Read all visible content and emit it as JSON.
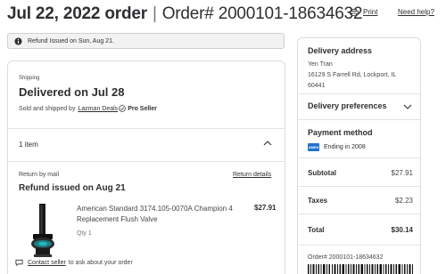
{
  "header": {
    "date_title": "Jul 22, 2022 order",
    "separator": "|",
    "order_number": "Order# 2000101-18634632",
    "print_label": "Print",
    "help_label": "Need help?"
  },
  "banner": {
    "text": "Refund Issued on Sun, Aug 21."
  },
  "shipment": {
    "label": "Shipping",
    "status": "Delivered on Jul 28",
    "sold_by_prefix": "Sold and shipped by",
    "seller": "Lazman Deals",
    "seller_badge": "Pro Seller"
  },
  "items": {
    "count_label": "1 item"
  },
  "return": {
    "method": "Return by mail",
    "details_link": "Return details",
    "status": "Refund issued on Aug 21"
  },
  "product": {
    "name": "American Standard 3174.105-0070A Champion 4 Replacement Flush Valve",
    "quantity": "Qty 1",
    "price": "$27.91"
  },
  "contact": {
    "link": "Contact seller",
    "suffix": "to ask about your order"
  },
  "sidebar": {
    "address_heading": "Delivery address",
    "address_lines": [
      "Yen Tran",
      "16129 S Farrell Rd, Lockport, IL",
      "60441"
    ],
    "preferences_heading": "Delivery preferences",
    "payment_heading": "Payment method",
    "card_brand": "AMEX",
    "card_text": "Ending in 2008",
    "subtotal_label": "Subtotal",
    "subtotal_value": "$27.91",
    "taxes_label": "Taxes",
    "taxes_value": "$2.23",
    "total_label": "Total",
    "total_value": "$30.14",
    "order_number": "Order# 2000101-18634632"
  },
  "colors": {
    "text": "#2e2f32",
    "muted": "#46474a",
    "border": "#dcdcde",
    "banner_bg": "#f2f2f2",
    "amex_blue": "#1f72cd",
    "badge_blue": "#0071dc"
  },
  "icons": [
    "printer-icon",
    "info-icon",
    "verified-check-icon",
    "chevron-up-icon",
    "chevron-down-icon",
    "chat-icon"
  ]
}
